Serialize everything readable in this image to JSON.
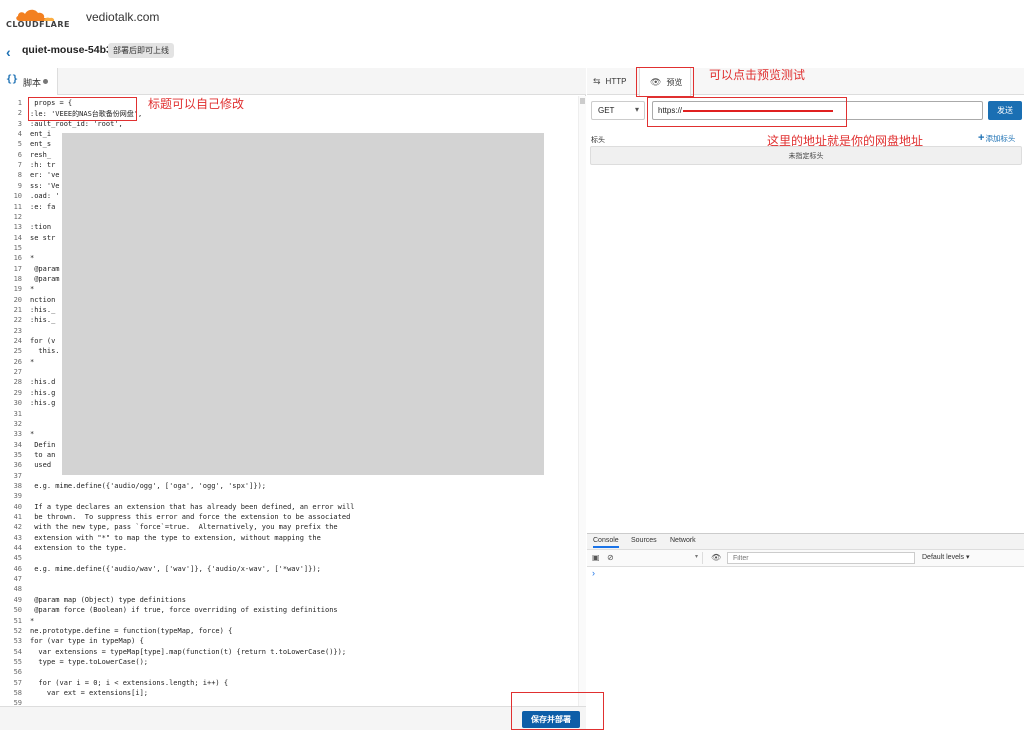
{
  "topbar": {
    "logo_text": "CLOUDFLARE",
    "domain": "vediotalk.com"
  },
  "worker": {
    "back_icon": "chevron-left-icon",
    "name": "quiet-mouse-54b3",
    "badge": "部署后即可上线"
  },
  "editor": {
    "tab_label": "脚本",
    "tab_icon": "curly-braces-icon",
    "deploy_label": "保存并部署",
    "lines": [
      {
        "n": "1",
        "code": " props = {"
      },
      {
        "n": "2",
        "code": ":le: 'VEEE的NAS台歌备份网盘',"
      },
      {
        "n": "3",
        "code": ":ault_root_id: 'root',"
      },
      {
        "n": "4",
        "code": "ent_i"
      },
      {
        "n": "5",
        "code": "ent_s"
      },
      {
        "n": "6",
        "code": "resh_"
      },
      {
        "n": "7",
        "code": ":h: tr"
      },
      {
        "n": "8",
        "code": "er: 've"
      },
      {
        "n": "9",
        "code": "ss: 'Ve"
      },
      {
        "n": "10",
        "code": ".oad: '"
      },
      {
        "n": "11",
        "code": ":e: fa"
      },
      {
        "n": "12",
        "code": ""
      },
      {
        "n": "13",
        "code": ":tion"
      },
      {
        "n": "14",
        "code": "se str"
      },
      {
        "n": "15",
        "code": ""
      },
      {
        "n": "16",
        "code": "*"
      },
      {
        "n": "17",
        "code": " @param"
      },
      {
        "n": "18",
        "code": " @param"
      },
      {
        "n": "19",
        "code": "*"
      },
      {
        "n": "20",
        "code": "nction"
      },
      {
        "n": "21",
        "code": ":his._"
      },
      {
        "n": "22",
        "code": ":his._"
      },
      {
        "n": "23",
        "code": ""
      },
      {
        "n": "24",
        "code": "for (v"
      },
      {
        "n": "25",
        "code": "  this."
      },
      {
        "n": "26",
        "code": "*"
      },
      {
        "n": "27",
        "code": ""
      },
      {
        "n": "28",
        "code": ":his.d"
      },
      {
        "n": "29",
        "code": ":his.g"
      },
      {
        "n": "30",
        "code": ":his.g"
      },
      {
        "n": "31",
        "code": ""
      },
      {
        "n": "32",
        "code": ""
      },
      {
        "n": "33",
        "code": "*"
      },
      {
        "n": "34",
        "code": " Defin"
      },
      {
        "n": "35",
        "code": " to an"
      },
      {
        "n": "36",
        "code": " used"
      },
      {
        "n": "37",
        "code": ""
      },
      {
        "n": "38",
        "code": " e.g. mime.define({'audio/ogg', ['oga', 'ogg', 'spx']});"
      },
      {
        "n": "39",
        "code": ""
      },
      {
        "n": "40",
        "code": " If a type declares an extension that has already been defined, an error will"
      },
      {
        "n": "41",
        "code": " be thrown.  To suppress this error and force the extension to be associated"
      },
      {
        "n": "42",
        "code": " with the new type, pass `force`=true.  Alternatively, you may prefix the"
      },
      {
        "n": "43",
        "code": " extension with \"*\" to map the type to extension, without mapping the"
      },
      {
        "n": "44",
        "code": " extension to the type."
      },
      {
        "n": "45",
        "code": ""
      },
      {
        "n": "46",
        "code": " e.g. mime.define({'audio/wav', ['wav']}, {'audio/x-wav', ['*wav']});"
      },
      {
        "n": "47",
        "code": ""
      },
      {
        "n": "48",
        "code": ""
      },
      {
        "n": "49",
        "code": " @param map (Object) type definitions"
      },
      {
        "n": "50",
        "code": " @param force (Boolean) if true, force overriding of existing definitions"
      },
      {
        "n": "51",
        "code": "*"
      },
      {
        "n": "52",
        "code": "ne.prototype.define = function(typeMap, force) {"
      },
      {
        "n": "53",
        "code": "for (var type in typeMap) {"
      },
      {
        "n": "54",
        "code": "  var extensions = typeMap[type].map(function(t) {return t.toLowerCase()});"
      },
      {
        "n": "55",
        "code": "  type = type.toLowerCase();"
      },
      {
        "n": "56",
        "code": ""
      },
      {
        "n": "57",
        "code": "  for (var i = 0; i < extensions.length; i++) {"
      },
      {
        "n": "58",
        "code": "    var ext = extensions[i];"
      },
      {
        "n": "59",
        "code": ""
      }
    ]
  },
  "right": {
    "tab_http": "HTTP",
    "tab_http_icon": "swap-arrows-icon",
    "tab_preview": "预览",
    "tab_preview_icon": "eye-icon",
    "method": "GET",
    "url_value": "https://",
    "send_label": "发送",
    "headers_label": "标头",
    "add_header_label": "添加标头",
    "no_headers_label": "未指定标头"
  },
  "devtools": {
    "tabs": [
      "Console",
      "Sources",
      "Network"
    ],
    "filter_placeholder": "Filter",
    "levels_label": "Default levels ▾",
    "prompt": "›"
  },
  "annotations": {
    "title_note": "标题可以自己修改",
    "preview_note": "可以点击预览测试",
    "url_note": "这里的地址就是你的网盘地址"
  },
  "colors": {
    "accent": "#1a6fb3",
    "annotation": "#e03030",
    "cloudflare_orange": "#f38020"
  }
}
